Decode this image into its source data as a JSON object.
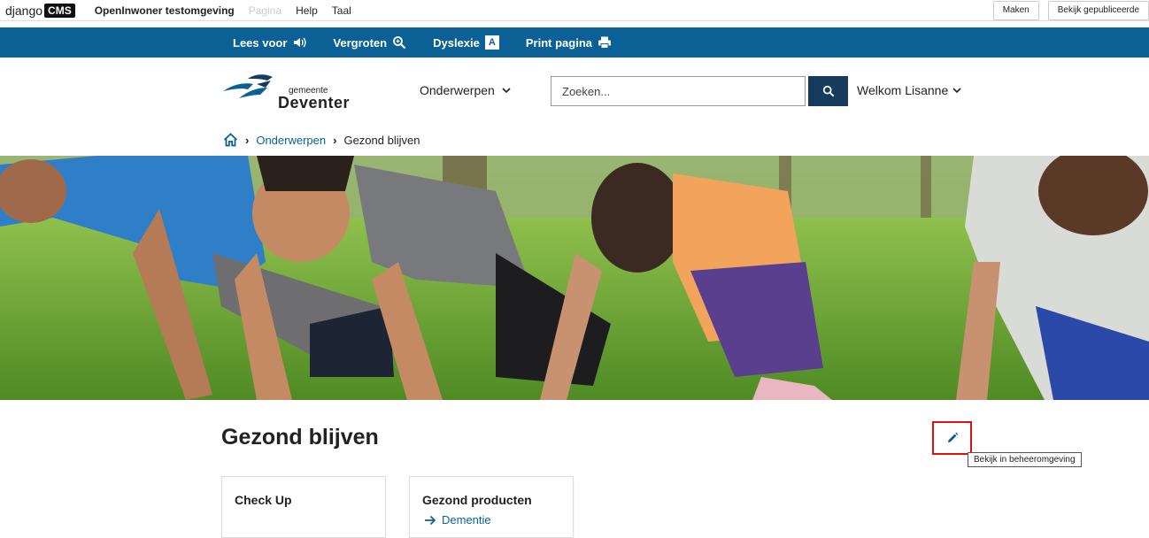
{
  "cms": {
    "logo_text": "django",
    "logo_badge": "CMS",
    "site_name": "OpenInwoner testomgeving",
    "menu_page": "Pagina",
    "menu_help": "Help",
    "menu_language": "Taal",
    "btn_create": "Maken",
    "btn_view_published": "Bekijk gepubliceerde"
  },
  "accessibility": {
    "read_aloud": "Lees voor",
    "zoom": "Vergroten",
    "dyslexia": "Dyslexie",
    "dyslexia_badge": "A",
    "print": "Print pagina",
    "bar_color": "#0b6196"
  },
  "header": {
    "logo_line1": "gemeente",
    "logo_line2": "Deventer",
    "topics_label": "Onderwerpen",
    "search_placeholder": "Zoeken...",
    "welcome": "Welkom Lisanne"
  },
  "breadcrumb": {
    "home_icon": "home-icon",
    "items": [
      "Onderwerpen",
      "Gezond blijven"
    ]
  },
  "main": {
    "title": "Gezond blijven",
    "edit_tooltip": "Bekijk in beheeromgeving",
    "cards": [
      {
        "title": "Check Up",
        "link": ""
      },
      {
        "title": "Gezond producten",
        "link": "Dementie"
      }
    ]
  }
}
